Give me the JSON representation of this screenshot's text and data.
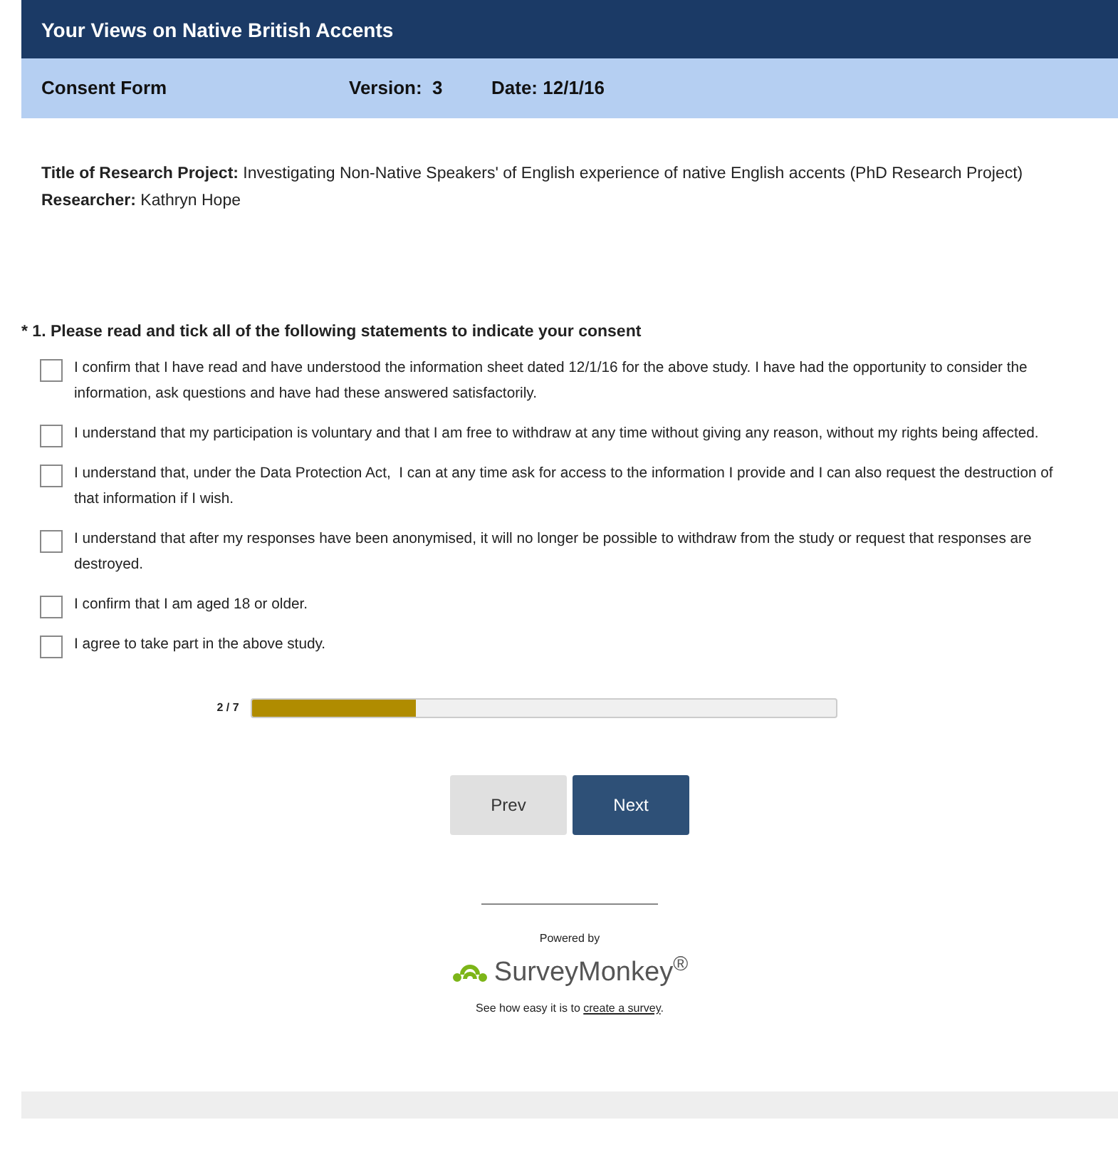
{
  "survey_title": "Your Views on Native British Accents",
  "subheader": {
    "form": "Consent Form",
    "version": "Version:  3",
    "date": "Date: 12/1/16"
  },
  "intro": [
    {
      "label": "Title of Research Project:",
      "text": " Investigating Non-Native Speakers' of English experience of native English accents (PhD Research Project)"
    },
    {
      "label": "Researcher:",
      "text": " Kathryn Hope"
    }
  ],
  "question": {
    "required_mark": "*",
    "title": "1. Please read and tick all of the following statements to indicate your consent",
    "options": [
      {
        "label": "I confirm that I have read and have understood the information sheet dated 12/1/16 for the above study. I have had the opportunity to consider the information, ask questions and have had these answered satisfactorily.",
        "checked": false
      },
      {
        "label": "I understand that my participation is voluntary and that I am free to withdraw at any time without giving any reason, without my rights being affected.",
        "checked": false
      },
      {
        "label": "I understand that, under the Data Protection Act,  I can at any time ask for access to the information I provide and I can also request the destruction of that information if I wish.",
        "checked": false
      },
      {
        "label": "I understand that after my responses have been anonymised, it will no longer be possible to withdraw from the study or request that responses are destroyed.",
        "checked": false
      },
      {
        "label": "I confirm that I am aged 18 or older.",
        "checked": false
      },
      {
        "label": "I agree to take part in the above study.",
        "checked": false
      }
    ]
  },
  "progress": {
    "label": "2 / 7",
    "level": 0.28
  },
  "buttons": [
    {
      "kind": "prev",
      "label": "Prev"
    },
    {
      "kind": "next",
      "label": "Next"
    }
  ],
  "footer": {
    "powered_by": "Powered by",
    "brand": "SurveyMonkey$^{®}$",
    "note_before": "See how easy it is to ",
    "link": "create a survey",
    "note_after": "."
  }
}
